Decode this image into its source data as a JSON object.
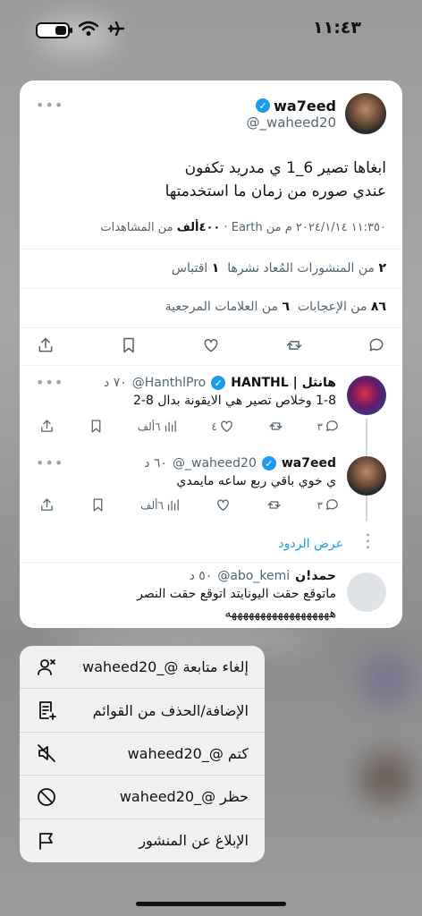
{
  "status_bar": {
    "time": "١١:٤٣"
  },
  "post": {
    "display_name": "wa7eed",
    "handle": "@_waheed20",
    "text_line1": "ابغاها تصير 6_1 ي مدريد تكفون",
    "text_line2": "عندي صوره من زمان ما استخدمتها",
    "meta_datetime": "١١:٣٥٠ ٢٠٢٤/١/١٤ م من Earth ·",
    "meta_views_count": "٤٠٠ألف",
    "meta_views_label": "من المشاهدات",
    "reposts_count": "٢",
    "reposts_label": "من المنشورات المُعاد نشرها",
    "quotes_count": "١",
    "quotes_label": "اقتباس",
    "likes_count": "٨٦",
    "likes_label": "من الإعجابات",
    "bookmarks_count": "٦",
    "bookmarks_label": "من العلامات المرجعية"
  },
  "replies": [
    {
      "display_name": "هانثل | HANTHL",
      "handle": "@HanthlPro",
      "time": "٧٠ د",
      "text": "1-8 وخلاص تصير هي الايقونة بدال 8-2",
      "reply_count": "٣",
      "like_count": "٤",
      "views": "٦ألف"
    },
    {
      "display_name": "wa7eed",
      "handle": "@_waheed20",
      "time": "٦٠ د",
      "text": "ي خوي باقي ربع ساعه مايمدي",
      "reply_count": "٣",
      "views": "٦ألف"
    },
    {
      "display_name": "حمد!ن",
      "handle": "@abo_kemi",
      "time": "٥٠ د",
      "text": "ماتوقع حقت اليونايتد اتوقع حقت النصر",
      "text2": "ههههههههههههههههههه"
    }
  ],
  "show_replies": "عرض الردود",
  "menu": {
    "unfollow": "إلغاء متابعة @_waheed20",
    "lists": "الإضافة/الحذف من القوائم",
    "mute": "كتم @_waheed20",
    "block": "حظر @_waheed20",
    "report": "الإبلاغ عن المنشور"
  }
}
